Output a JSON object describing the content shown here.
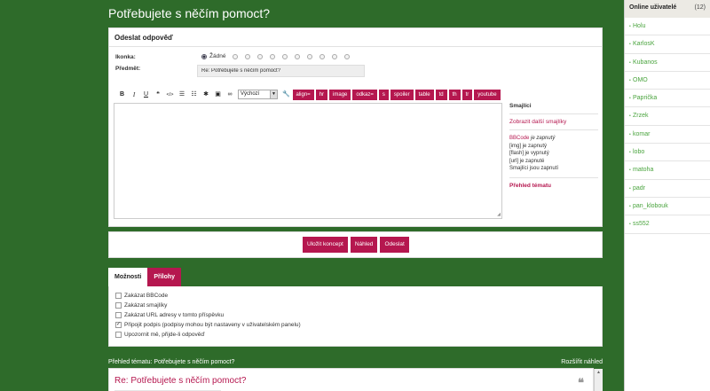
{
  "page": {
    "title": "Potřebujete s něčím pomoct?"
  },
  "reply": {
    "heading": "Odeslat odpověď",
    "icon_label": "Ikonka:",
    "icon_none": "Žádné",
    "subject_label": "Předmět:",
    "subject_value": "Re: Potřebujete s něčím pomoct?",
    "font_select": "Výchozí",
    "toolbar_icons": [
      "B",
      "I",
      "U",
      "❝",
      "</>",
      "☰",
      "☷",
      "✱",
      "▣",
      "∞"
    ],
    "bbcode_buttons": [
      "align=",
      "hr",
      "image",
      "odkaz=",
      "s",
      "spoiler",
      "table",
      "td",
      "th",
      "tr",
      "youtube"
    ],
    "smilies_title": "Smajlíci",
    "more_smilies": "Zobrazit další smajlíky",
    "bbcode_link": "BBCode",
    "bbcode_status": "je zapnutý",
    "img_status": "[img] je zapnutý",
    "flash_status": "[flash] je vypnutý",
    "url_status": "[url] je zapnuté",
    "smilies_status": "Smajlíci jsou zapnutí",
    "topic_review_link": "Přehled tématu"
  },
  "submit": {
    "save_draft": "Uložit koncept",
    "preview": "Náhled",
    "send": "Odeslat"
  },
  "tabs": {
    "options": "Možnosti",
    "attachments": "Přílohy"
  },
  "options": {
    "items": [
      {
        "label": "Zakázat BBCode",
        "checked": false
      },
      {
        "label": "Zakázat smajlíky",
        "checked": false
      },
      {
        "label": "Zakázat URL adresy v tomto příspěvku",
        "checked": false
      },
      {
        "label": "Připojit podpis (podpisy mohou být nastaveny v uživatelském panelu)",
        "checked": true
      },
      {
        "label": "Upozornit mě, přijde-li odpověď",
        "checked": false
      }
    ]
  },
  "review": {
    "heading": "Přehled tématu: Potřebujete s něčím pomoct?",
    "expand": "Rozšířit náhled",
    "post_title": "Re: Potřebujete s něčím pomoct?",
    "quote_icon": "quote-icon"
  },
  "sidebar": {
    "title": "Online uživatelé",
    "count": "(12)",
    "users": [
      "Holu",
      "KarlosK",
      "Kubanos",
      "OMO",
      "Paprička",
      "Zrzek",
      "komar",
      "lobo",
      "matoha",
      "padr",
      "pan_klobouk",
      "ss552"
    ]
  },
  "colors": {
    "background": "#2e6b2a",
    "accent": "#b5174f",
    "user_link": "#4aa43e"
  }
}
